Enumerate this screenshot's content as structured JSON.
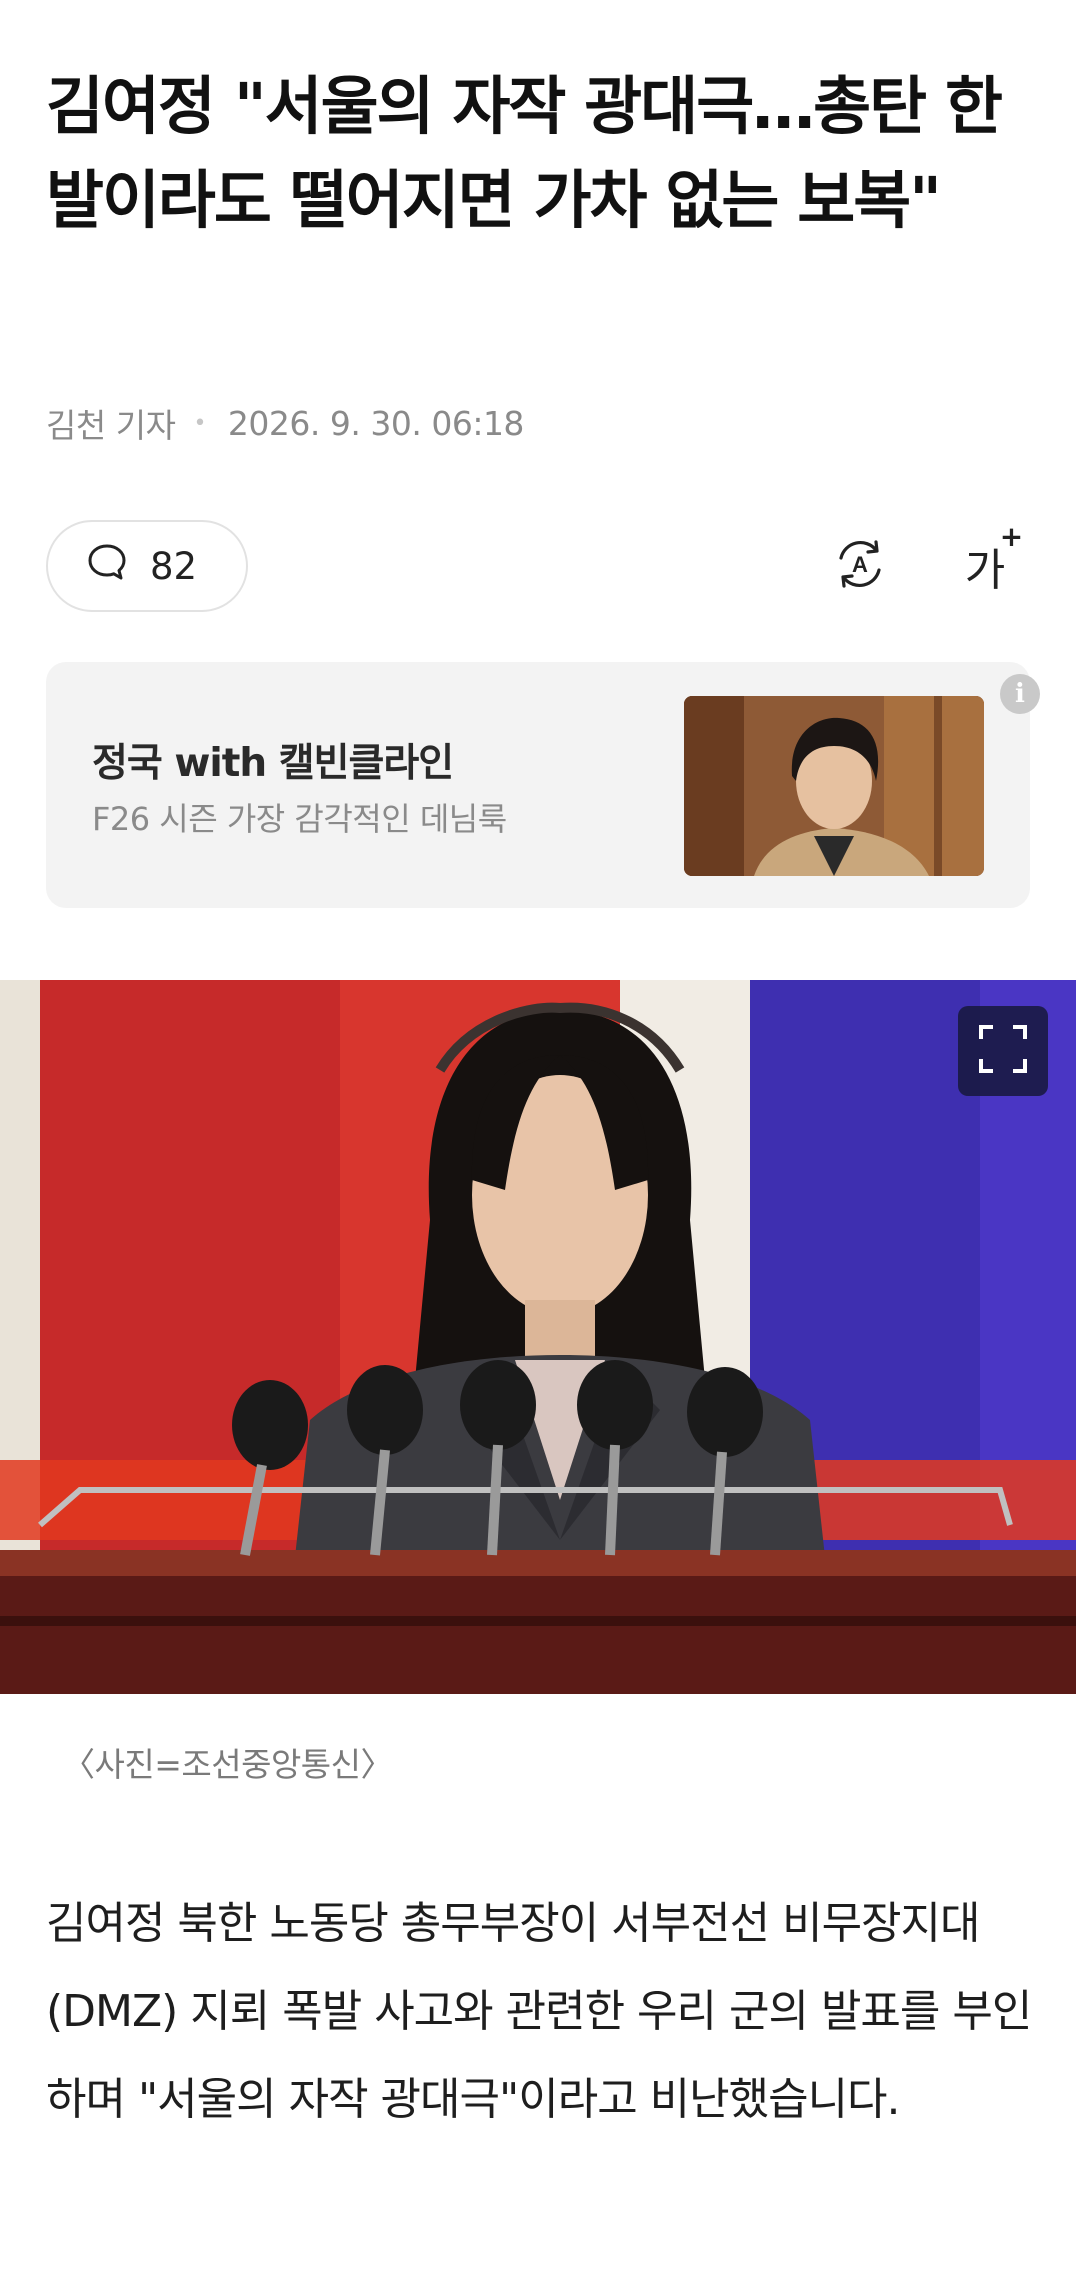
{
  "article": {
    "headline": "김여정 \"서울의 자작 광대극…총탄 한발이라도 떨어지면 가차 없는 보복\"",
    "reporter": "김천 기자",
    "datetime": "2026. 9. 30. 06:18",
    "comment_count": "82",
    "photo_caption": "〈사진=조선중앙통신〉",
    "body": "김여정 북한 노동당 총무부장이 서부전선 비무장지대(DMZ) 지뢰 폭발 사고와 관련한 우리 군의 발표를 부인하며 \"서울의 자작 광대극\"이라고 비난했습니다."
  },
  "toolbar": {
    "translate_icon": "translate-icon",
    "fontsize_label": "가",
    "fontsize_plus": "+"
  },
  "ad": {
    "title": "정국 with 캘빈클라인",
    "subtitle": "F26 시즌 가장 감각적인 데님룩",
    "info_label": "i"
  },
  "colors": {
    "text_primary": "#111111",
    "text_secondary": "#8a8a8a",
    "ad_background": "#f3f3f3",
    "expand_button_bg": "#16183c"
  }
}
